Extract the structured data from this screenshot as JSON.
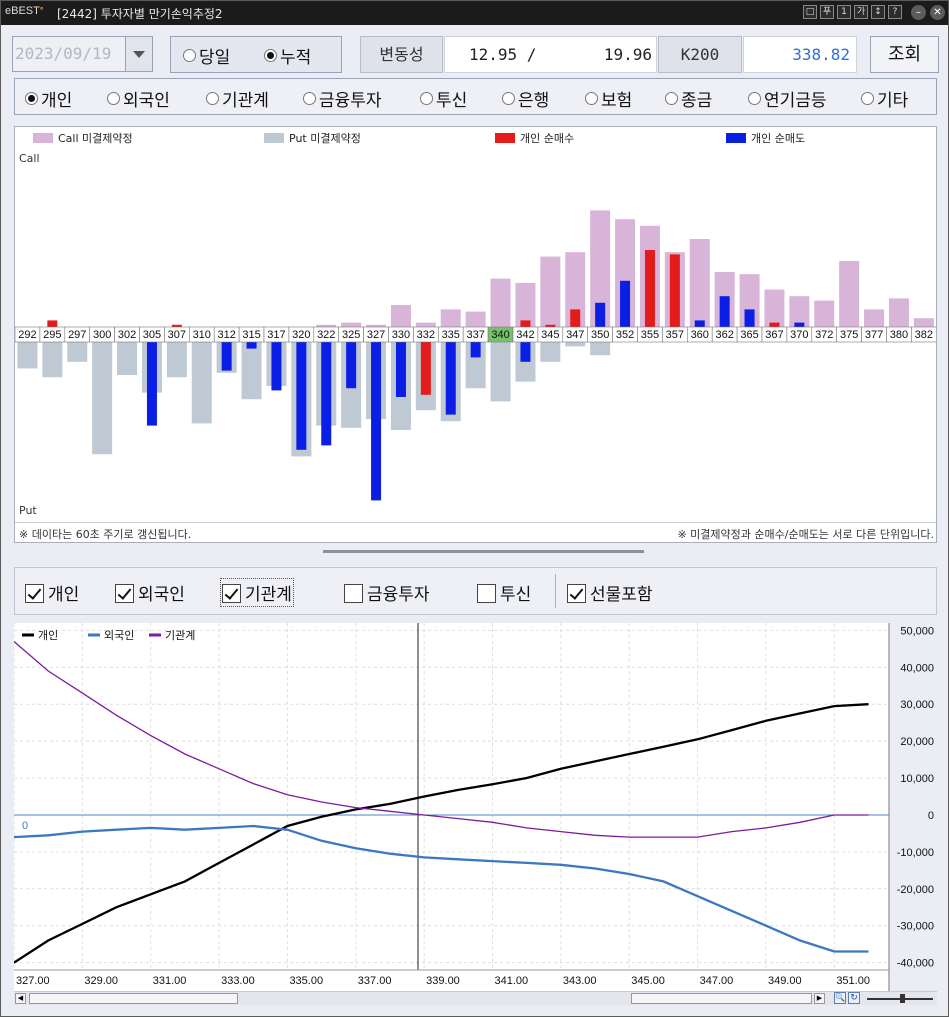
{
  "window": {
    "logo": "eBEST",
    "title": "[2442] 투자자별 만기손익추정2",
    "buttons": [
      "□",
      "푸",
      "1",
      "가",
      "↕",
      "?"
    ]
  },
  "toolbar": {
    "date_value": "2023/09/19",
    "mode_options": [
      {
        "label": "당일",
        "selected": false
      },
      {
        "label": "누적",
        "selected": true
      }
    ],
    "volatility_label": "변동성",
    "volatility_value": "12.95 /       19.96",
    "k200_label": "K200",
    "k200_value": "338.82",
    "query_button": "조회"
  },
  "investors": [
    {
      "label": "개인",
      "selected": true
    },
    {
      "label": "외국인",
      "selected": false
    },
    {
      "label": "기관계",
      "selected": false
    },
    {
      "label": "금융투자",
      "selected": false
    },
    {
      "label": "투신",
      "selected": false
    },
    {
      "label": "은행",
      "selected": false
    },
    {
      "label": "보험",
      "selected": false
    },
    {
      "label": "종금",
      "selected": false
    },
    {
      "label": "연기금등",
      "selected": false
    },
    {
      "label": "기타",
      "selected": false
    }
  ],
  "oi_chart": {
    "legend": [
      {
        "label": "Call 미결제약정",
        "color": "#d8b4d8"
      },
      {
        "label": "Put 미결제약정",
        "color": "#bfc9d4"
      },
      {
        "label": "개인 순매수",
        "color": "#e41b1b"
      },
      {
        "label": "개인 순매도",
        "color": "#0a1ee6"
      }
    ],
    "call_label": "Call",
    "put_label": "Put",
    "footnote_left": "※ 데이타는 60초 주기로 갱신됩니다.",
    "footnote_right": "※ 미결제약정과 순매수/순매도는 서로 다른 단위입니다.",
    "highlight_strike": "340"
  },
  "chart_data": [
    {
      "type": "bar",
      "categories": [
        "292",
        "295",
        "297",
        "300",
        "302",
        "305",
        "307",
        "310",
        "312",
        "315",
        "317",
        "320",
        "322",
        "325",
        "327",
        "330",
        "332",
        "335",
        "337",
        "340",
        "342",
        "345",
        "347",
        "350",
        "352",
        "355",
        "357",
        "360",
        "362",
        "365",
        "367",
        "370",
        "372",
        "375",
        "377",
        "380",
        "382"
      ],
      "series": [
        {
          "name": "Call 미결제약정",
          "values": [
            0,
            0,
            0,
            0,
            0,
            0,
            0,
            0,
            0,
            0,
            0,
            0,
            1,
            2,
            1,
            10,
            2,
            8,
            7,
            22,
            20,
            32,
            34,
            53,
            49,
            46,
            34,
            40,
            25,
            24,
            17,
            14,
            12,
            30,
            8,
            13,
            4
          ]
        },
        {
          "name": "Put 미결제약정",
          "values": [
            -12,
            -16,
            -9,
            -51,
            -15,
            -23,
            -16,
            -37,
            -14,
            -26,
            -20,
            -52,
            -38,
            -39,
            -35,
            -40,
            -31,
            -36,
            -21,
            -27,
            -18,
            -9,
            -2,
            -6,
            0,
            0,
            0,
            0,
            0,
            0,
            0,
            0,
            0,
            0,
            0,
            0,
            0
          ]
        },
        {
          "name": "개인 순매수",
          "values": [
            0,
            3,
            0,
            0,
            0,
            0,
            1,
            0,
            0,
            0,
            0,
            0,
            0,
            0,
            0,
            0,
            24,
            0,
            0,
            0,
            3,
            1,
            8,
            0,
            0,
            35,
            33,
            0,
            0,
            0,
            2,
            0,
            0,
            0,
            0,
            0,
            0
          ]
        },
        {
          "name": "개인 순매도",
          "values": [
            0,
            0,
            0,
            0,
            0,
            38,
            0,
            0,
            13,
            3,
            22,
            49,
            47,
            21,
            72,
            25,
            0,
            33,
            7,
            0,
            9,
            0,
            0,
            11,
            21,
            0,
            0,
            3,
            14,
            8,
            0,
            2,
            0,
            0,
            0,
            0,
            0
          ]
        }
      ],
      "ylabel_top": "Call",
      "ylabel_bottom": "Put"
    },
    {
      "type": "line",
      "legend": [
        {
          "name": "개인",
          "color": "#000000",
          "checked": true
        },
        {
          "name": "외국인",
          "color": "#3a78c2",
          "checked": true
        },
        {
          "name": "기관계",
          "color": "#7d1a9e",
          "checked": true
        },
        {
          "name": "금융투자",
          "checked": false
        },
        {
          "name": "투신",
          "checked": false
        },
        {
          "name": "선물포함",
          "checked": true
        }
      ],
      "x": [
        327.0,
        328.0,
        329.0,
        330.0,
        331.0,
        332.0,
        333.0,
        334.0,
        335.0,
        336.0,
        337.0,
        338.0,
        339.0,
        340.0,
        341.0,
        342.0,
        343.0,
        344.0,
        345.0,
        346.0,
        347.0,
        348.0,
        349.0,
        350.0,
        351.0,
        352.0
      ],
      "series": [
        {
          "name": "개인",
          "values": [
            -40000,
            -34000,
            -29500,
            -25000,
            -21500,
            -18000,
            -13000,
            -8000,
            -3000,
            -500,
            1500,
            3000,
            5000,
            6800,
            8300,
            10000,
            12500,
            14500,
            16500,
            18500,
            20500,
            23000,
            25500,
            27500,
            29500,
            30000
          ]
        },
        {
          "name": "외국인",
          "values": [
            -6000,
            -5500,
            -4500,
            -4000,
            -3500,
            -4000,
            -3500,
            -3000,
            -4000,
            -7000,
            -9000,
            -10500,
            -11500,
            -12000,
            -12500,
            -13000,
            -13500,
            -14500,
            -16000,
            -18000,
            -22000,
            -26000,
            -30000,
            -34000,
            -37000,
            -37000
          ]
        },
        {
          "name": "기관계",
          "values": [
            47000,
            39000,
            33000,
            27000,
            21500,
            16500,
            12500,
            8500,
            5500,
            3500,
            2000,
            1000,
            0,
            -1000,
            -2000,
            -3500,
            -4500,
            -5500,
            -6000,
            -6000,
            -6000,
            -4500,
            -3500,
            -2000,
            0,
            0
          ]
        }
      ],
      "ylim": [
        -42000,
        52000
      ],
      "y_ticks": [
        "50,000",
        "40,000",
        "30,000",
        "20,000",
        "10,000",
        "0",
        "-10,000",
        "-20,000",
        "-30,000",
        "-40,000"
      ],
      "x_ticks": [
        "327.00",
        "329.00",
        "331.00",
        "333.00",
        "335.00",
        "337.00",
        "339.00",
        "341.00",
        "343.00",
        "345.00",
        "347.00",
        "349.00",
        "351.00"
      ],
      "zero_label": "0"
    }
  ]
}
